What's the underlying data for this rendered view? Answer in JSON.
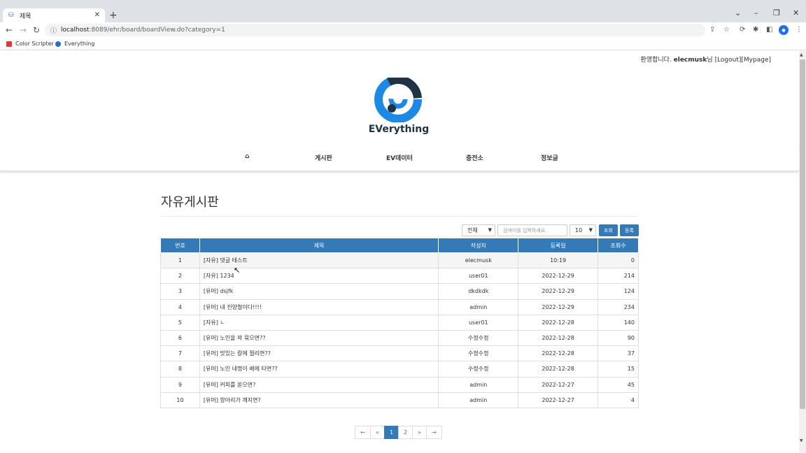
{
  "browser": {
    "tab_title": "제목",
    "url_host": "localhost",
    "url_path": ":8089/ehr/board/boardView.do?category=1",
    "bookmarks": [
      {
        "label": "Color Scripter",
        "color": "#e53935"
      },
      {
        "label": "Everything",
        "color": "#2a6fc6"
      }
    ]
  },
  "header": {
    "welcome_prefix": "환영합니다. ",
    "username": "elecmusk",
    "welcome_suffix": "님",
    "logout": "[Logout]",
    "mypage": "[Mypage]",
    "logo_text": "EVerything"
  },
  "nav": {
    "home_icon": "home-icon",
    "items": [
      "게시판",
      "EV데이터",
      "충전소",
      "정보글"
    ]
  },
  "board": {
    "title": "자유게시판",
    "filter_select": "전체",
    "search_placeholder": "검색어를 입력하세요.",
    "page_size": "10",
    "search_button": "조회",
    "write_button": "등록",
    "columns": [
      "번호",
      "제목",
      "작성자",
      "등록일",
      "조회수"
    ],
    "rows": [
      {
        "no": "1",
        "title": "[자유] 댓글 테스트",
        "author": "elecmusk",
        "date": "10:19",
        "views": "0"
      },
      {
        "no": "2",
        "title": "[자유] 1234",
        "author": "user01",
        "date": "2022-12-29",
        "views": "214"
      },
      {
        "no": "3",
        "title": "[유머] dsjfk",
        "author": "dkdkdk",
        "date": "2022-12-29",
        "views": "124"
      },
      {
        "no": "4",
        "title": "[유머] 내 진양철이다!!!!",
        "author": "admin",
        "date": "2022-12-29",
        "views": "234"
      },
      {
        "no": "5",
        "title": "[자유] ㄴ",
        "author": "user01",
        "date": "2022-12-28",
        "views": "140"
      },
      {
        "no": "6",
        "title": "[유머] 노인을 꽉 묶으면??",
        "author": "수정수정",
        "date": "2022-12-28",
        "views": "90"
      },
      {
        "no": "7",
        "title": "[유머] 맛있는 칼에 찔리면??",
        "author": "수정수정",
        "date": "2022-12-28",
        "views": "37"
      },
      {
        "no": "8",
        "title": "[유머] 노인 네명이 배에 타면??",
        "author": "수정수정",
        "date": "2022-12-28",
        "views": "15"
      },
      {
        "no": "9",
        "title": "[유머] 커피를 쏟으면?",
        "author": "admin",
        "date": "2022-12-27",
        "views": "45"
      },
      {
        "no": "10",
        "title": "[유머] 항아리가 깨지면?",
        "author": "admin",
        "date": "2022-12-27",
        "views": "4"
      }
    ]
  },
  "pagination": {
    "first": "←",
    "prev": "«",
    "pages": [
      "1",
      "2"
    ],
    "current": "1",
    "next": "»",
    "last": "→"
  },
  "colors": {
    "accent": "#337ab7",
    "logo_blue": "#1e88e5",
    "logo_dark": "#1f3342"
  }
}
